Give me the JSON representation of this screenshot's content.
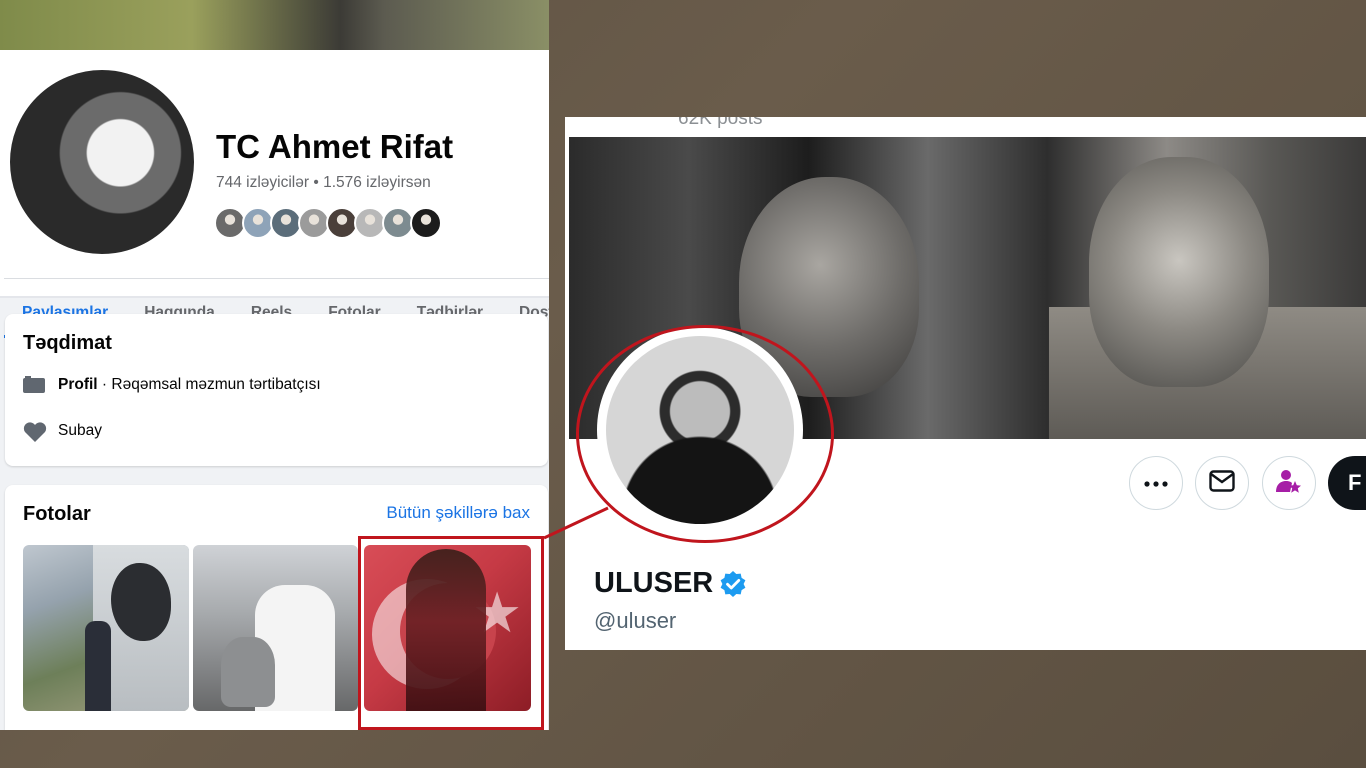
{
  "facebook": {
    "profile_name": "TC Ahmet Rifat",
    "follow_stats": "744 izləyicilər • 1.576 izləyirsən",
    "friend_avatar_colors": [
      "#6a6a6a",
      "#8ea3b8",
      "#5b6d7a",
      "#9b9b9b",
      "#4a3f3a",
      "#b8b8b8",
      "#7d8b90",
      "#1c1c1c"
    ],
    "tabs": [
      {
        "label": "Paylaşımlar",
        "active": true
      },
      {
        "label": "Haqqında",
        "active": false
      },
      {
        "label": "Reels",
        "active": false
      },
      {
        "label": "Fotolar",
        "active": false
      },
      {
        "label": "Tədbirlər",
        "active": false
      },
      {
        "label": "Dost",
        "active": false
      }
    ],
    "intro": {
      "title": "Təqdimat",
      "profile_label": "Profil",
      "profile_detail": " · Rəqəmsal məzmun tərtibatçısı",
      "relationship": "Subay"
    },
    "photos": {
      "title": "Fotolar",
      "see_all": "Bütün şəkillərə bax"
    },
    "accent_color": "#1b74e4"
  },
  "twitter": {
    "posts_count": "62K posts",
    "display_name": "ULUSER",
    "handle": "@uluser",
    "follow_label": "F",
    "verified_color": "#1d9bf0",
    "subscribe_color": "#a61ea6"
  },
  "annotation": {
    "highlight_color": "#c0151d"
  }
}
